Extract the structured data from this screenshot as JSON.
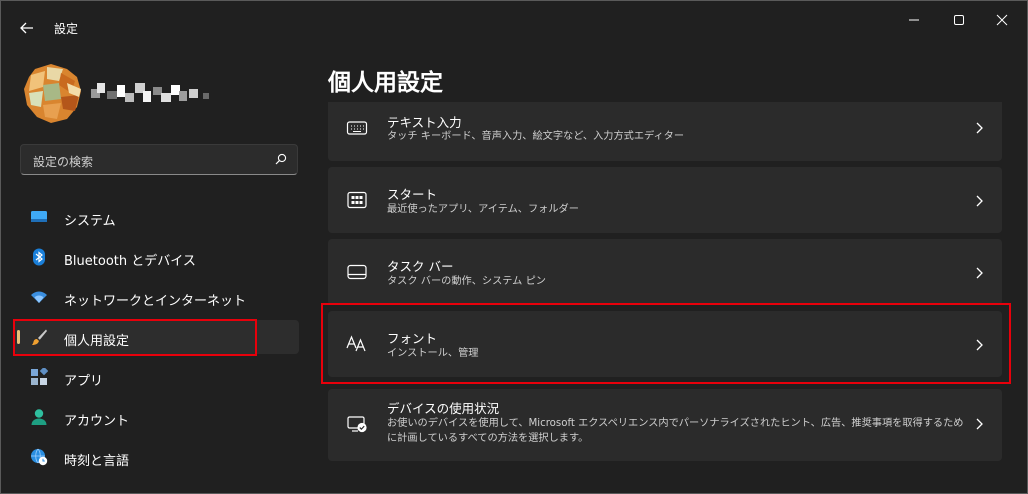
{
  "window": {
    "title": "設定"
  },
  "search": {
    "placeholder": "設定の検索"
  },
  "sidebar": {
    "items": [
      {
        "label": "システム",
        "icon": "monitor-icon"
      },
      {
        "label": "Bluetooth とデバイス",
        "icon": "bluetooth-icon"
      },
      {
        "label": "ネットワークとインターネット",
        "icon": "wifi-icon"
      },
      {
        "label": "個人用設定",
        "icon": "paintbrush-icon",
        "active": true
      },
      {
        "label": "アプリ",
        "icon": "apps-icon"
      },
      {
        "label": "アカウント",
        "icon": "account-icon"
      },
      {
        "label": "時刻と言語",
        "icon": "globe-clock-icon"
      }
    ]
  },
  "main": {
    "title": "個人用設定",
    "cards": [
      {
        "title": "テキスト入力",
        "subtitle": "タッチ キーボード、音声入力、絵文字など、入力方式エディター",
        "icon": "keyboard-icon"
      },
      {
        "title": "スタート",
        "subtitle": "最近使ったアプリ、アイテム、フォルダー",
        "icon": "start-icon"
      },
      {
        "title": "タスク バー",
        "subtitle": "タスク バーの動作、システム ピン",
        "icon": "taskbar-icon"
      },
      {
        "title": "フォント",
        "subtitle": "インストール、管理",
        "icon": "font-icon",
        "highlighted": true
      },
      {
        "title": "デバイスの使用状況",
        "subtitle": "お使いのデバイスを使用して、Microsoft エクスペリエンス内でパーソナライズされたヒント、広告、推奨事項を取得するために計画しているすべての方法を選択します。",
        "icon": "device-usage-icon"
      }
    ]
  },
  "colors": {
    "highlight_box": "#e8000b",
    "active_indicator": "#e8c07a",
    "card_background": "#2b2b2b",
    "window_background": "#202020"
  }
}
